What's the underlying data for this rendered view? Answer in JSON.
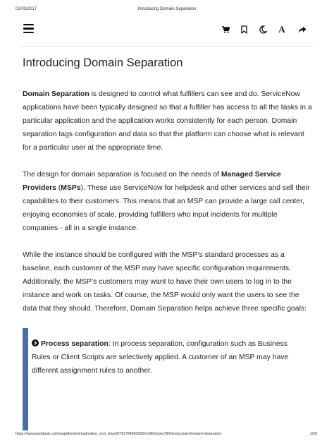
{
  "print_header": {
    "date": "01/03/2017",
    "title": "Introducing Domain Separation"
  },
  "toolbar": {
    "menu_icon": "hamburger-menu-icon",
    "icons": [
      "cart-icon",
      "bookmark-icon",
      "moon-icon",
      "font-icon",
      "share-icon"
    ],
    "font_label": "A"
  },
  "article": {
    "title": "Introducing Domain Separation",
    "p1": {
      "term": "Domain Separation",
      "text": " is designed to control what fulfillers can see and do. ServiceNow applications have been typically designed so that a fulfiller has access to all the tasks in a particular application and the application works consistently for each person. Domain separation tags configuration and data so that the platform can choose what is relevant for a particular user at the appropriate time."
    },
    "p2": {
      "pre": "The design for domain separation is focused on the needs of ",
      "term": "Managed Service Providers",
      "mid": " (",
      "abbr": "MSPs",
      "text": "). These use ServiceNow for helpdesk and other services and sell their capabilities to their customers. This means that an MSP can provide a large call center, enjoying economies of scale, providing fulfillers who input incidents for multiple companies - all in a single instance."
    },
    "p3": "While the instance should be configured with the MSP’s standard processes as a baseline, each customer of the MSP may have specific configuration requirements. Additionally, the MSP’s customers may want to have their own users to log in to the instance and work on tasks. Of course, the MSP would only want the users to see the data that they should. Therefore, Domain Separation helps achieve three specific goals:",
    "callout": {
      "icon": "chevron-circle-right-icon",
      "term": "Process separation",
      "text": ": In process separation, configuration such as Business Rules or Client Scripts are selectively applied. A customer of an MSP may have different assignment rules to another."
    }
  },
  "print_footer": {
    "url": "https://www.packtpub.com/mapt/book/virtualization_and_cloud/9781784695569/ch08lvl1sec79/Introducing+Domain+Separation",
    "page": "1/28"
  },
  "colors": {
    "accent_bar": "#4a6fa5",
    "text": "#222222",
    "divider": "#e2e2e2"
  }
}
